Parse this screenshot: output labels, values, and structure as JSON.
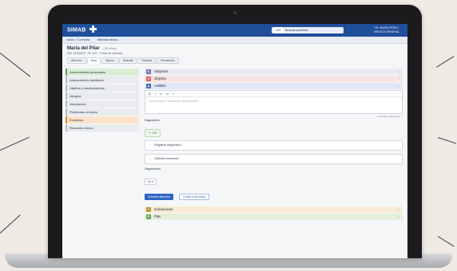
{
  "app": {
    "logo_text": "SIMAB",
    "search_tag": "001",
    "search_text": "Buscar paciente",
    "user_name": "DR. MARÍA PÉREZ",
    "user_role": "MÉDICO GENERAL"
  },
  "breadcrumb": [
    "Inicio / Consulta",
    "Historia clínica"
  ],
  "patient": {
    "name": "Maria del Pilar",
    "name_suffix": "(28 años)",
    "meta": "DNI 12345678  ·  HC 001  ·  Fecha de consulta"
  },
  "patient_tabs": [
    "Atención",
    "Nota",
    "Signos",
    "Historial",
    "Recetas",
    "Resultados"
  ],
  "sidebar": {
    "items": [
      {
        "label": "Antecedentes personales",
        "tone": "green"
      },
      {
        "label": "Antecedentes familiares",
        "tone": "gray"
      },
      {
        "label": "Hábitos y medicamentos",
        "tone": "gray"
      },
      {
        "label": "Alergias",
        "tone": "gray"
      },
      {
        "label": "Vacunación",
        "tone": "gray"
      },
      {
        "label": "Problemas crónicos",
        "tone": "gray"
      },
      {
        "label": "Evolución",
        "tone": "orange"
      },
      {
        "label": "Resumen clínico",
        "tone": "gray"
      }
    ]
  },
  "soap": {
    "s": {
      "letter": "S",
      "label": "Subjetivo"
    },
    "o": {
      "letter": "O",
      "label": "Objetivo"
    },
    "a": {
      "letter": "A",
      "label": "Análisis"
    },
    "p": {
      "letter": "P",
      "label": "Plan"
    },
    "plan_extra": {
      "letter": "I",
      "label": "Indicaciones"
    }
  },
  "editor": {
    "toolbar": [
      "B",
      "I",
      "U",
      "S",
      "≡"
    ],
    "placeholder": "Escriba aquí la evaluación del paciente...",
    "save_note": "Guardado automático"
  },
  "diagnosis": {
    "label": "Diagnóstico",
    "chip_label": "CIE"
  },
  "actions": [
    "Registrar diagnóstico",
    "Solicitar exámenes"
  ],
  "followup": {
    "label": "Seguimiento",
    "select_value": "No"
  },
  "buttons": {
    "primary": "Guardar atención",
    "secondary": "Enviar a farmacia"
  }
}
